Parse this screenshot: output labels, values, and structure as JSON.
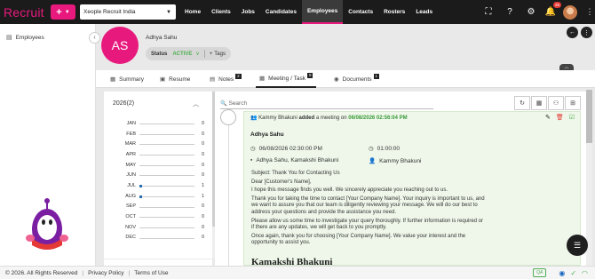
{
  "app": {
    "logo": "Recruit",
    "company": "Xeople Recruit India"
  },
  "nav": [
    "Home",
    "Clients",
    "Jobs",
    "Candidates",
    "Employees",
    "Contacts",
    "Rosters",
    "Leads"
  ],
  "nav_active": "Employees",
  "notifications_count": "26",
  "sidebar": {
    "item": "Employees"
  },
  "profile": {
    "initials": "AS",
    "name": "Adhya Sahu",
    "status_label": "Status",
    "status_value": "ACTIVE",
    "tags_label": "Tags"
  },
  "tabs": [
    {
      "label": "Summary",
      "count": ""
    },
    {
      "label": "Resume",
      "count": ""
    },
    {
      "label": "Notes",
      "count": "2"
    },
    {
      "label": "Meeting / Task",
      "count": "9"
    },
    {
      "label": "Documents",
      "count": "1"
    }
  ],
  "year_panel": {
    "year": "2026(2)",
    "months": [
      {
        "name": "JAN",
        "count": 0
      },
      {
        "name": "FEB",
        "count": 0
      },
      {
        "name": "MAR",
        "count": 0
      },
      {
        "name": "APR",
        "count": 0
      },
      {
        "name": "MAY",
        "count": 0
      },
      {
        "name": "JUN",
        "count": 0
      },
      {
        "name": "JUL",
        "count": 1
      },
      {
        "name": "AUG",
        "count": 1
      },
      {
        "name": "SEP",
        "count": 0
      },
      {
        "name": "OCT",
        "count": 0
      },
      {
        "name": "NOV",
        "count": 0
      },
      {
        "name": "DEC",
        "count": 0
      }
    ]
  },
  "search": {
    "placeholder": "Search"
  },
  "meeting": {
    "author": "Kammy Bhakuni",
    "action": "added",
    "what": "a meeting on",
    "date": "06/08/2026 02:56:04 PM",
    "title": "Adhya Sahu",
    "when": "06/08/2026 02:30:00 PM",
    "duration": "01:00:00",
    "attendees": "Adhya Sahu, Kamakshi Bhakuni",
    "organizer": "Kammy Bhakuni",
    "body": [
      "Subject: Thank You for Contacting Us",
      "Dear [Customer's Name],",
      "I hope this message finds you well. We sincerely appreciate you reaching out to us.",
      "Thank you for taking the time to contact [Your Company Name]. Your inquiry is important to us, and we want to assure you that our team is diligently reviewing your message. We will do our best to address your questions and provide the assistance you need.",
      "Please allow us some time to investigate your query thoroughly. If further information is required or if there are any updates, we will get back to you promptly.",
      "Once again, thank you for choosing [Your Company Name]. We value your interest and the opportunity to assist you."
    ],
    "signature": "Kamakshi Bhakuni"
  },
  "footer": {
    "copyright": "© 2026. All Rights Reserved",
    "privacy": "Privacy Policy",
    "terms": "Terms of Use",
    "env": "QA"
  },
  "colors": {
    "brand": "#e8197d",
    "navbar": "#1b1b1b",
    "active_status": "#4caf50",
    "meeting_card": "#eef7e9"
  }
}
